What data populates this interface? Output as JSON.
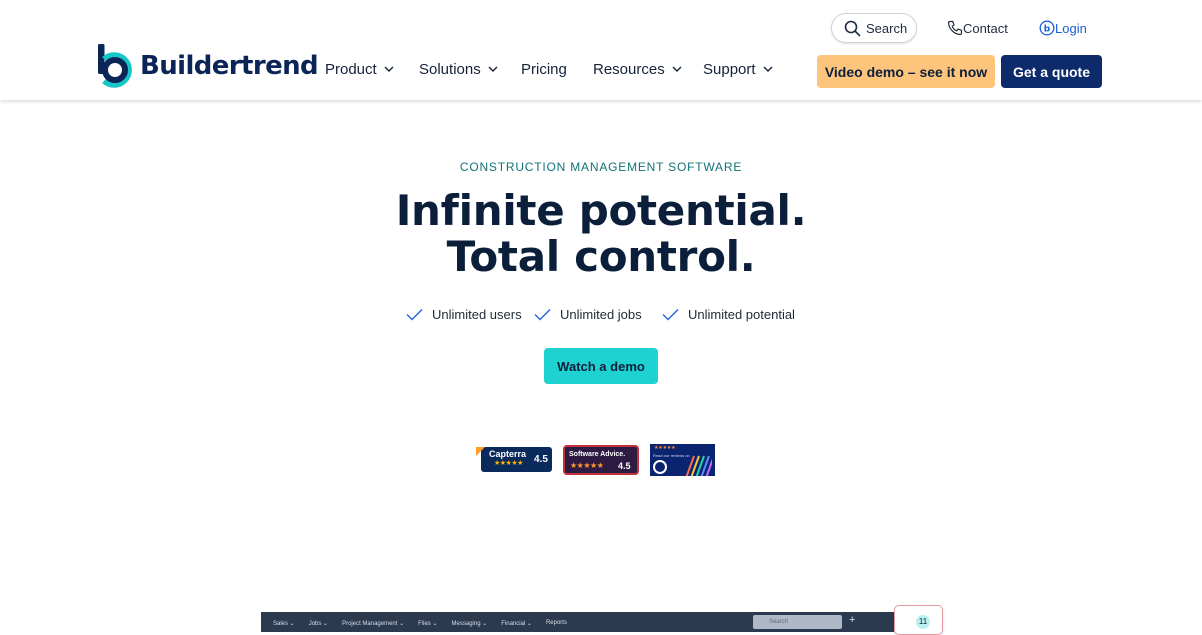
{
  "brand": {
    "name": "Buildertrend"
  },
  "utility": {
    "search_label": "Search",
    "contact_label": "Contact",
    "login_label": "Login"
  },
  "nav": {
    "product": "Product",
    "solutions": "Solutions",
    "pricing": "Pricing",
    "resources": "Resources",
    "support": "Support"
  },
  "cta": {
    "video_demo": "Video demo – see it now",
    "get_quote": "Get a quote",
    "watch_demo": "Watch a demo"
  },
  "hero": {
    "eyebrow": "CONSTRUCTION MANAGEMENT SOFTWARE",
    "headline_line1": "Infinite potential.",
    "headline_line2": "Total control.",
    "features": [
      "Unlimited users",
      "Unlimited jobs",
      "Unlimited potential"
    ]
  },
  "badges": {
    "capterra": {
      "name": "Capterra",
      "score": "4.5",
      "stars": "★★★★★"
    },
    "software_advice": {
      "name": "Software Advice.",
      "score": "4.5",
      "stars": "★★★★★"
    },
    "g2": {
      "stars": "★★★★★",
      "text": "Read our reviews on"
    }
  },
  "preview": {
    "menu": [
      "Sales ⌄",
      "Jobs ⌄",
      "Project Management ⌄",
      "Files ⌄",
      "Messaging ⌄",
      "Financial ⌄",
      "Reports"
    ],
    "search_placeholder": "Search",
    "notification_count": "11"
  },
  "colors": {
    "navy": "#0b1f3a",
    "quote_button": "#0d2a6b",
    "video_button": "#fdc47c",
    "demo_button": "#1fd2d2",
    "eyebrow": "#10727a",
    "logo_teal": "#17c7c8",
    "logo_navy": "#0b2557",
    "link_blue": "#1a5fd6"
  },
  "icons": {
    "search": "search-icon",
    "contact": "phone-icon",
    "login": "user-circle-icon",
    "chevron": "chevron-down-icon",
    "check": "check-icon"
  }
}
